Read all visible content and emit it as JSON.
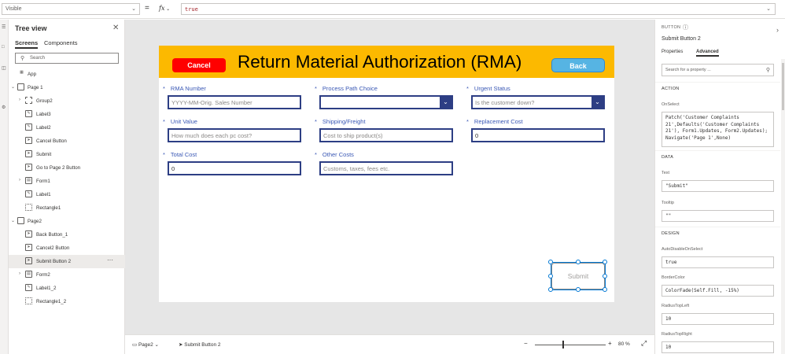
{
  "formula_bar": {
    "property": "Visible",
    "fx_label": "fx",
    "formula": "true"
  },
  "tree": {
    "title": "Tree view",
    "tabs": [
      "Screens",
      "Components"
    ],
    "search_placeholder": "Search",
    "items": [
      {
        "label": "App"
      },
      {
        "label": "Page 1"
      },
      {
        "label": "Group2"
      },
      {
        "label": "Label3"
      },
      {
        "label": "Label2"
      },
      {
        "label": "Cancel Button"
      },
      {
        "label": "Submit"
      },
      {
        "label": "Go to Page 2 Button"
      },
      {
        "label": "Form1"
      },
      {
        "label": "Label1"
      },
      {
        "label": "Rectangle1"
      },
      {
        "label": "Page2"
      },
      {
        "label": "Back Button_1"
      },
      {
        "label": "Cancel2 Button"
      },
      {
        "label": "Submit Button 2"
      },
      {
        "label": "Form2"
      },
      {
        "label": "Label1_2"
      },
      {
        "label": "Rectangle1_2"
      }
    ]
  },
  "app": {
    "title": "Return Material Authorization (RMA)",
    "cancel_label": "Cancel",
    "back_label": "Back",
    "submit_label": "Submit",
    "fields": [
      {
        "label": "RMA Number",
        "placeholder": "YYYY-MM-Orig. Sales Number"
      },
      {
        "label": "Process Path Choice",
        "placeholder": ""
      },
      {
        "label": "Urgent Status",
        "placeholder": "Is the customer down?"
      },
      {
        "label": "Unit Value",
        "placeholder": "How much does each pc cost?"
      },
      {
        "label": "Shipping/Freight",
        "placeholder": "Cost to ship product(s)"
      },
      {
        "label": "Replacement Cost",
        "value": "0"
      },
      {
        "label": "Total Cost",
        "value": "0"
      },
      {
        "label": "Other Costs",
        "placeholder": "Customs, taxes, fees etc."
      }
    ]
  },
  "status_bar": {
    "screen": "Page2",
    "control": "Submit Button 2",
    "zoom": "80",
    "zoom_unit": "%",
    "zoom_fraction": 0.4
  },
  "props": {
    "type": "BUTTON",
    "name": "Submit Button 2",
    "tabs": [
      "Properties",
      "Advanced"
    ],
    "search_placeholder": "Search for a property ...",
    "sections": {
      "action": "ACTION",
      "data": "DATA",
      "design": "DESIGN"
    },
    "on_select_label": "OnSelect",
    "on_select_value": "Patch('Customer Complaints 21',Defaults('Customer Complaints 21'), Form1.Updates, Form2.Updates); Navigate('Page 1',None)",
    "text_label": "Text",
    "text_value": "\"Submit\"",
    "tooltip_label": "Tooltip",
    "tooltip_value": "\"\"",
    "auto_disable_label": "AutoDisableOnSelect",
    "auto_disable_value": "true",
    "border_color_label": "BorderColor",
    "border_color_value": "ColorFade(Self.Fill, -15%)",
    "radius_top_left_label": "RadiusTopLeft",
    "radius_top_left_value": "10",
    "radius_top_right_label": "RadiusTopRight",
    "radius_top_right_value": "10"
  },
  "colors": {
    "header": "#fcb900",
    "cancel": "#ff0000",
    "back": "#56b4e3",
    "field_border": "#2d3e84",
    "label": "#3a58b5",
    "selection": "#0078d4"
  }
}
